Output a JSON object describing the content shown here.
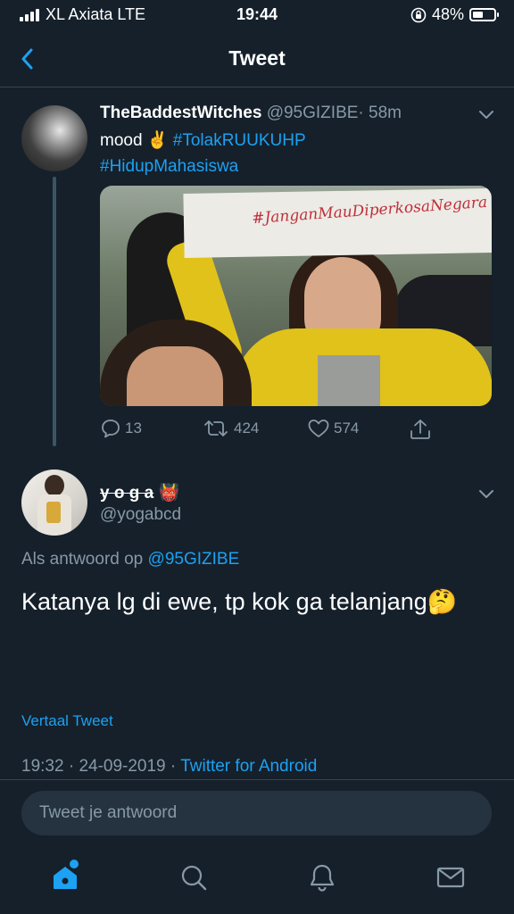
{
  "status_bar": {
    "carrier": "XL Axiata LTE",
    "time": "19:44",
    "battery": "48%",
    "battery_level": 0.48,
    "icons": [
      "signal-icon",
      "orientation-lock-icon",
      "battery-icon"
    ]
  },
  "nav": {
    "title": "Tweet",
    "back_icon": "chevron-left-icon"
  },
  "parent_tweet": {
    "display_name": "TheBaddestWitches",
    "handle": "@95GIZIBE",
    "separator": "·",
    "age": "58m",
    "text_prefix": "mood",
    "emoji": "✌️",
    "hashtag_1": "#TolakRUUKUHP",
    "hashtag_2": "#HidupMahasiswa",
    "media_banner_text": "#JanganMauDiperkosaNegara",
    "actions": {
      "replies": "13",
      "retweets": "424",
      "likes": "574"
    }
  },
  "main_tweet": {
    "display_name": "y o g a",
    "name_emoji": "👹",
    "handle": "@yogabcd",
    "reply_label": "Als antwoord op",
    "reply_handle": "@95GIZIBE",
    "text": "Katanya lg di ewe, tp kok ga telanjang",
    "text_emoji": "🤔",
    "translate_label": "Vertaal Tweet",
    "time": "19:32",
    "date": "24-09-2019",
    "source": "Twitter for Android",
    "separator": "·"
  },
  "reply_box": {
    "placeholder": "Tweet je antwoord"
  },
  "tabbar": {
    "items": [
      "home-icon",
      "search-icon",
      "notifications-icon",
      "messages-icon"
    ],
    "accent": "#1da1f2"
  },
  "colors": {
    "background": "#15202b",
    "accent": "#1da1f2",
    "muted": "#8899a6",
    "divider": "#38444d"
  }
}
